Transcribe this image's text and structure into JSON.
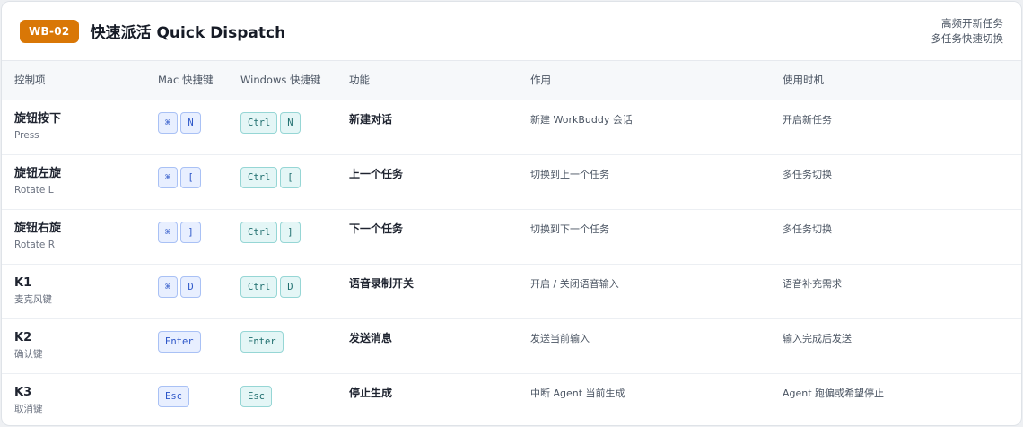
{
  "header": {
    "badge": "WB-02",
    "title": "快速派活 Quick Dispatch",
    "note_line1": "高频开新任务",
    "note_line2": "多任务快速切换"
  },
  "columns": [
    "控制项",
    "Mac 快捷键",
    "Windows 快捷键",
    "功能",
    "作用",
    "使用时机"
  ],
  "rows": [
    {
      "name": "旋钮按下",
      "sub": "Press",
      "mac": [
        "⌘",
        "N"
      ],
      "win": [
        "Ctrl",
        "N"
      ],
      "function": "新建对话",
      "effect": "新建 WorkBuddy 会话",
      "timing": "开启新任务"
    },
    {
      "name": "旋钮左旋",
      "sub": "Rotate L",
      "mac": [
        "⌘",
        "["
      ],
      "win": [
        "Ctrl",
        "["
      ],
      "function": "上一个任务",
      "effect": "切换到上一个任务",
      "timing": "多任务切换"
    },
    {
      "name": "旋钮右旋",
      "sub": "Rotate R",
      "mac": [
        "⌘",
        "]"
      ],
      "win": [
        "Ctrl",
        "]"
      ],
      "function": "下一个任务",
      "effect": "切换到下一个任务",
      "timing": "多任务切换"
    },
    {
      "name": "K1",
      "sub": "麦克风键",
      "mac": [
        "⌘",
        "D"
      ],
      "win": [
        "Ctrl",
        "D"
      ],
      "function": "语音录制开关",
      "effect": "开启 / 关闭语音输入",
      "timing": "语音补充需求"
    },
    {
      "name": "K2",
      "sub": "确认键",
      "mac": [
        "Enter"
      ],
      "win": [
        "Enter"
      ],
      "function": "发送消息",
      "effect": "发送当前输入",
      "timing": "输入完成后发送"
    },
    {
      "name": "K3",
      "sub": "取消键",
      "mac": [
        "Esc"
      ],
      "win": [
        "Esc"
      ],
      "function": "停止生成",
      "effect": "中断 Agent 当前生成",
      "timing": "Agent 跑偏或希望停止"
    }
  ],
  "colors": {
    "badge": "#d97706",
    "mac_key": "#2c56c8",
    "win_key": "#1f6e6e"
  }
}
